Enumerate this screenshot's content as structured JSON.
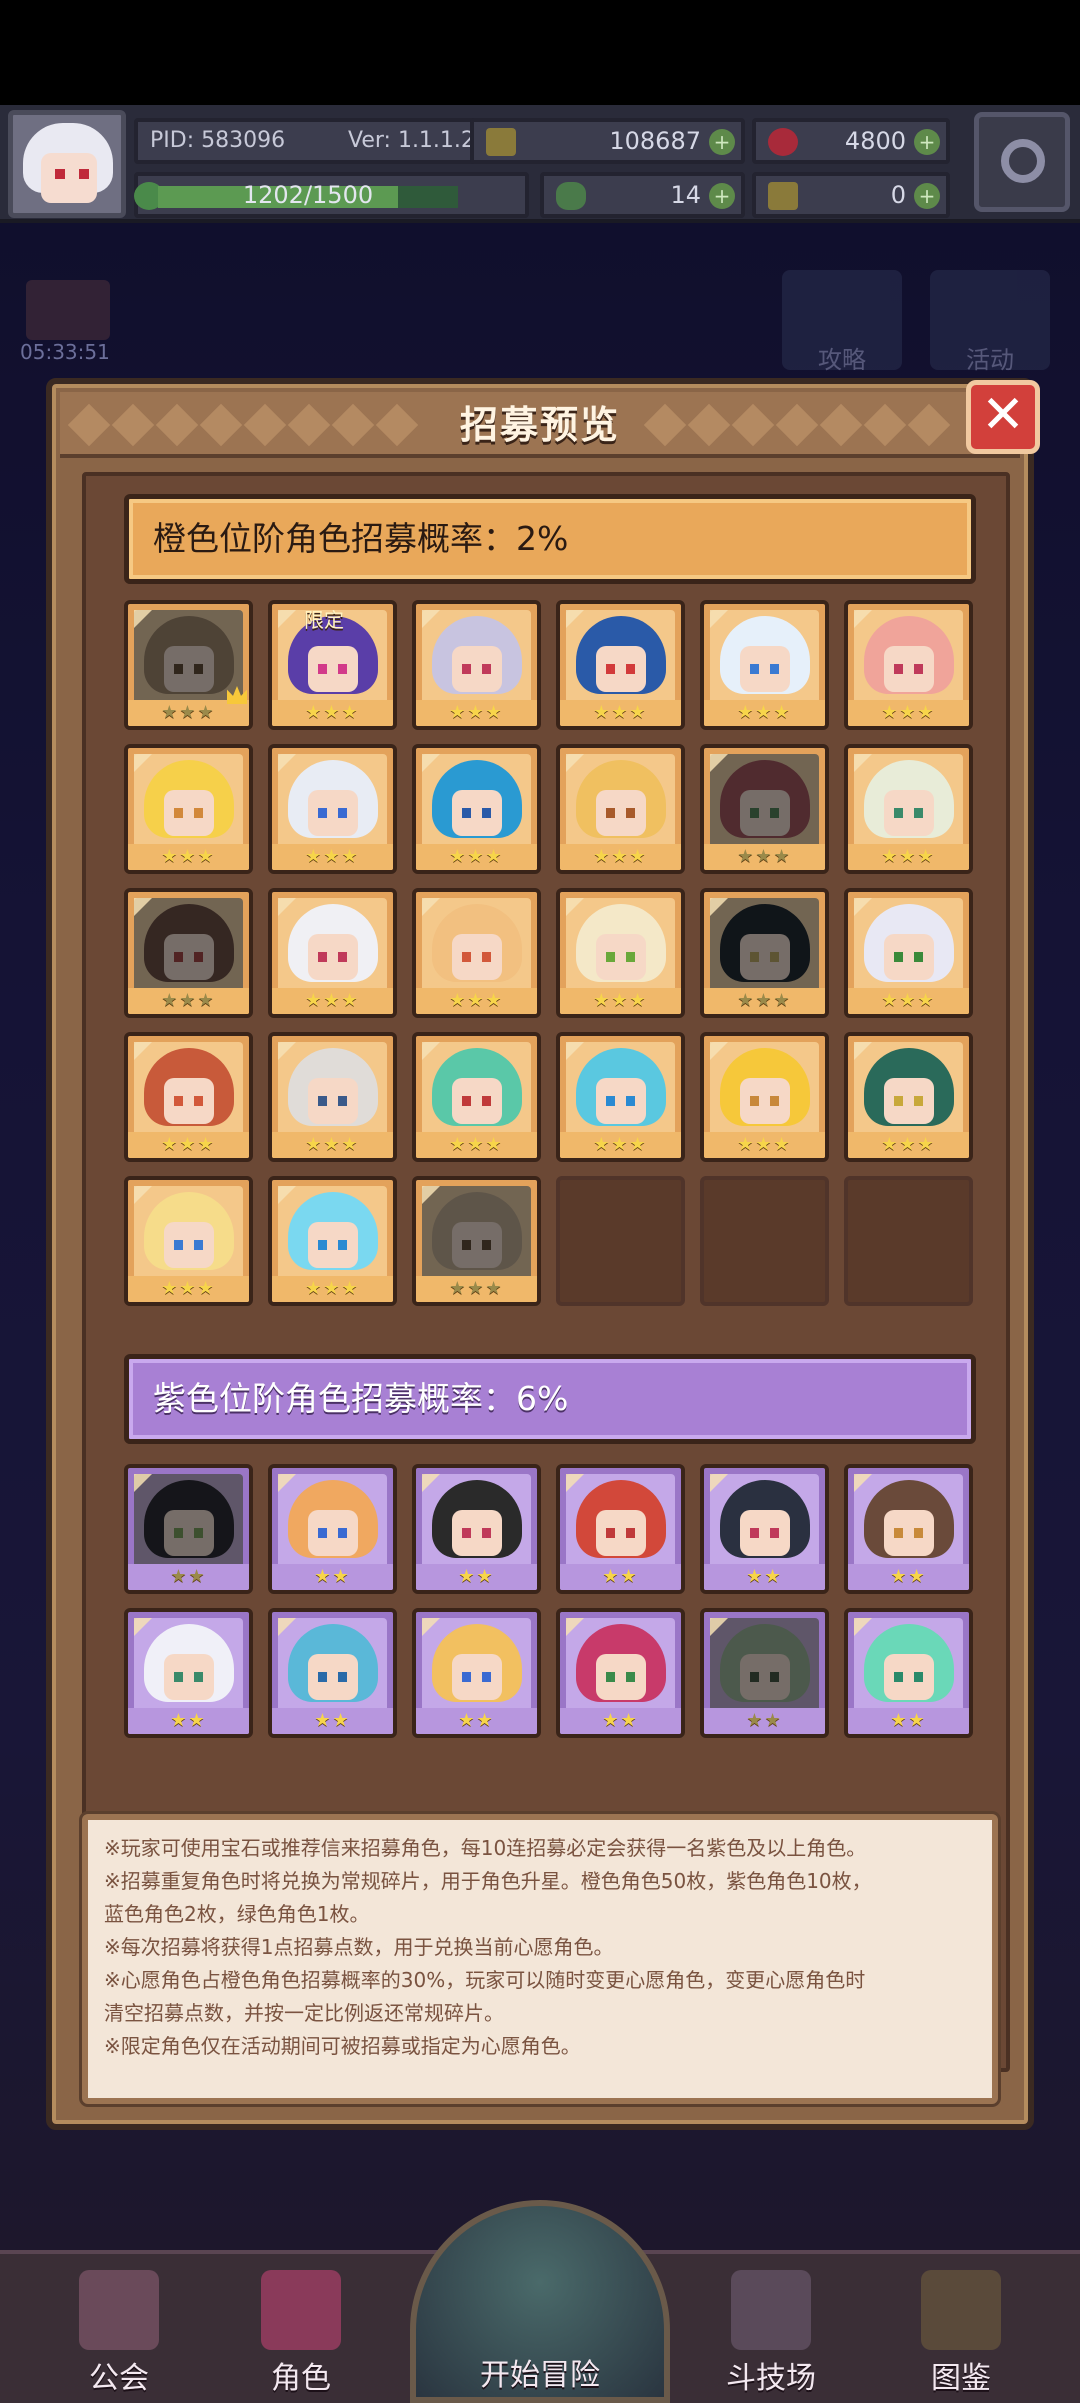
{
  "topbar": {
    "pid": "PID: 583096",
    "version": "Ver: 1.1.1.2",
    "gold": "108687",
    "gems": "4800",
    "exp": "1202/1500",
    "clover": "14",
    "tickets": "0"
  },
  "background": {
    "timer": "05:33:51",
    "guide_label": "攻略",
    "event_label": "活动"
  },
  "modal": {
    "title": "招募预览",
    "close_icon": "close-icon",
    "orange_tier": {
      "label": "橙色位阶角色招募概率：2%",
      "color": "#e9a85a",
      "limited_badge": "限定",
      "stars": "★★★",
      "cards": [
        {
          "hair": "#a8845a",
          "eye": "#6a4a2a",
          "dim": true,
          "badge": false,
          "crown": true
        },
        {
          "hair": "#5a3ea8",
          "eye": "#d23a8a",
          "dim": false,
          "badge": true,
          "crown": false
        },
        {
          "hair": "#c8c4e0",
          "eye": "#c03a5a",
          "dim": false,
          "badge": false,
          "crown": false
        },
        {
          "hair": "#2a5aa8",
          "eye": "#d23a3a",
          "dim": false,
          "badge": false,
          "crown": false
        },
        {
          "hair": "#e6f0fa",
          "eye": "#3a7ad2",
          "dim": false,
          "badge": false,
          "crown": false
        },
        {
          "hair": "#f0a49a",
          "eye": "#c03a5a",
          "dim": false,
          "badge": false,
          "crown": false
        },
        {
          "hair": "#f6d04a",
          "eye": "#d2883a",
          "dim": false,
          "badge": false,
          "crown": false
        },
        {
          "hair": "#e8ecf4",
          "eye": "#3a6ad2",
          "dim": false,
          "badge": false,
          "crown": false
        },
        {
          "hair": "#2a9ad2",
          "eye": "#2a5aa8",
          "dim": false,
          "badge": false,
          "crown": false
        },
        {
          "hair": "#f0c060",
          "eye": "#a85a2a",
          "dim": false,
          "badge": false,
          "crown": false
        },
        {
          "hair": "#c84a5a",
          "eye": "#3a8a4a",
          "dim": true,
          "badge": false,
          "crown": false
        },
        {
          "hair": "#e8ecd8",
          "eye": "#3a8a6a",
          "dim": false,
          "badge": false,
          "crown": false
        },
        {
          "hair": "#7a4a3a",
          "eye": "#d23a3a",
          "dim": true,
          "badge": false,
          "crown": false
        },
        {
          "hair": "#f0f0f4",
          "eye": "#c03a5a",
          "dim": false,
          "badge": false,
          "crown": false
        },
        {
          "hair": "#f2c080",
          "eye": "#d2583a",
          "dim": false,
          "badge": false,
          "crown": false
        },
        {
          "hair": "#f4e8c8",
          "eye": "#6aa83a",
          "dim": false,
          "badge": false,
          "crown": false
        },
        {
          "hair": "#1a2a3a",
          "eye": "#c8a83a",
          "dim": true,
          "badge": false,
          "crown": false
        },
        {
          "hair": "#e8e8f4",
          "eye": "#3a8a3a",
          "dim": false,
          "badge": false,
          "crown": false
        },
        {
          "hair": "#c85a3a",
          "eye": "#d2583a",
          "dim": false,
          "badge": false,
          "crown": false
        },
        {
          "hair": "#e0dcd8",
          "eye": "#3a5a8a",
          "dim": false,
          "badge": false,
          "crown": false
        },
        {
          "hair": "#5ac8a8",
          "eye": "#c03a3a",
          "dim": false,
          "badge": false,
          "crown": false
        },
        {
          "hair": "#5ac8e0",
          "eye": "#2a8ad2",
          "dim": false,
          "badge": false,
          "crown": false
        },
        {
          "hair": "#f6c83a",
          "eye": "#c8883a",
          "dim": false,
          "badge": false,
          "crown": false
        },
        {
          "hair": "#2a6a5a",
          "eye": "#c8a83a",
          "dim": false,
          "badge": false,
          "crown": false
        },
        {
          "hair": "#f6dc8a",
          "eye": "#3a7ad2",
          "dim": false,
          "badge": false,
          "crown": false
        },
        {
          "hair": "#7ad8f0",
          "eye": "#2a8ad2",
          "dim": false,
          "badge": false,
          "crown": false
        },
        {
          "hair": "#c8a880",
          "eye": "#6a4a2a",
          "dim": true,
          "badge": false,
          "crown": false
        }
      ],
      "empty_slots": 3
    },
    "purple_tier": {
      "label": "紫色位阶角色招募概率：6%",
      "color": "#a880d4",
      "stars": "★★",
      "cards": [
        {
          "hair": "#2a2a3a",
          "eye": "#6aa83a",
          "dim": true
        },
        {
          "hair": "#f0a860",
          "eye": "#3a6ad2",
          "dim": false
        },
        {
          "hair": "#2a2a2a",
          "eye": "#c03a5a",
          "dim": false
        },
        {
          "hair": "#d2483a",
          "eye": "#c03a3a",
          "dim": false
        },
        {
          "hair": "#2a3040",
          "eye": "#c03a5a",
          "dim": false
        },
        {
          "hair": "#6a4a3a",
          "eye": "#c88a3a",
          "dim": false
        },
        {
          "hair": "#f0f0f8",
          "eye": "#3a8a6a",
          "dim": false
        },
        {
          "hair": "#5ab8d8",
          "eye": "#2a6aa8",
          "dim": false
        },
        {
          "hair": "#f2c060",
          "eye": "#3a6ad2",
          "dim": false
        },
        {
          "hair": "#c83a6a",
          "eye": "#3a8a4a",
          "dim": false
        },
        {
          "hair": "#8ab88a",
          "eye": "#3a5a3a",
          "dim": true
        },
        {
          "hair": "#6ad8b8",
          "eye": "#2a8a6a",
          "dim": false
        }
      ]
    },
    "notes": [
      "※玩家可使用宝石或推荐信来招募角色，每10连招募必定会获得一名紫色及以上角色。",
      "※招募重复角色时将兑换为常规碎片，用于角色升星。橙色角色50枚，紫色角色10枚，",
      "蓝色角色2枚，绿色角色1枚。",
      "※每次招募将获得1点招募点数，用于兑换当前心愿角色。",
      "※心愿角色占橙色角色招募概率的30%，玩家可以随时变更心愿角色，变更心愿角色时",
      "清空招募点数，并按一定比例返还常规碎片。",
      "※限定角色仅在活动期间可被招募或指定为心愿角色。"
    ]
  },
  "bottom_nav": {
    "guild": "公会",
    "characters": "角色",
    "start": "开始冒险",
    "arena": "斗技场",
    "codex": "图鉴"
  }
}
